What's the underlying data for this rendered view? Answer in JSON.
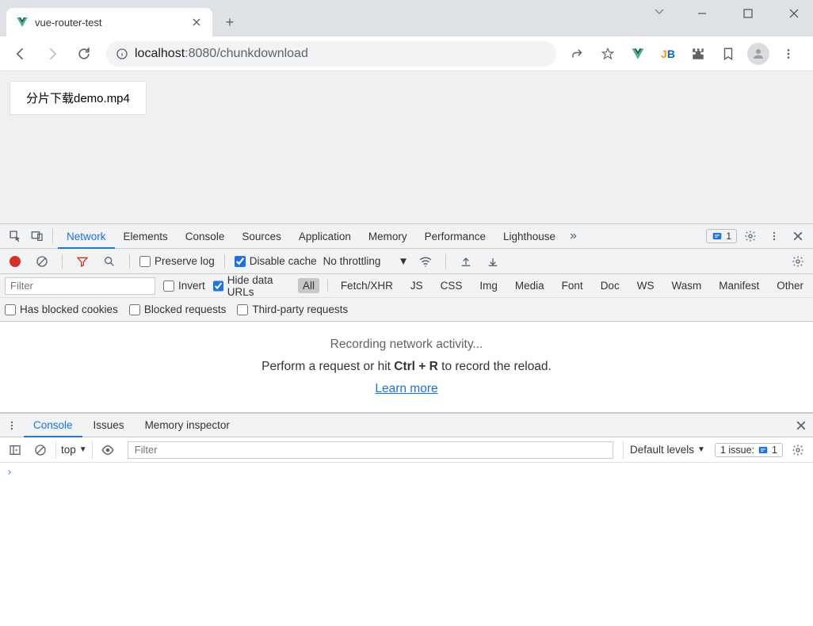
{
  "window": {
    "tab_title": "vue-router-test"
  },
  "addressbar": {
    "host": "localhost",
    "port": ":8080",
    "path": "/chunkdownload"
  },
  "page": {
    "download_button": "分片下载demo.mp4"
  },
  "devtools": {
    "tabs": [
      "Network",
      "Elements",
      "Console",
      "Sources",
      "Application",
      "Memory",
      "Performance",
      "Lighthouse"
    ],
    "active_tab": 0,
    "issue_count": "1"
  },
  "network_toolbar": {
    "preserve_log": "Preserve log",
    "disable_cache": "Disable cache",
    "throttling": "No throttling"
  },
  "filter": {
    "placeholder": "Filter",
    "invert": "Invert",
    "hide_data_urls": "Hide data URLs",
    "types": [
      "All",
      "Fetch/XHR",
      "JS",
      "CSS",
      "Img",
      "Media",
      "Font",
      "Doc",
      "WS",
      "Wasm",
      "Manifest",
      "Other"
    ],
    "has_blocked_cookies": "Has blocked cookies",
    "blocked_requests": "Blocked requests",
    "third_party": "Third-party requests"
  },
  "empty_state": {
    "title": "Recording network activity...",
    "sub_prefix": "Perform a request or hit ",
    "sub_key": "Ctrl + R",
    "sub_suffix": " to record the reload.",
    "learn_more": "Learn more"
  },
  "drawer": {
    "tabs": [
      "Console",
      "Issues",
      "Memory inspector"
    ],
    "active_tab": 0,
    "context": "top",
    "filter_placeholder": "Filter",
    "levels": "Default levels",
    "issues_label": "1 issue:",
    "issues_count": "1"
  }
}
